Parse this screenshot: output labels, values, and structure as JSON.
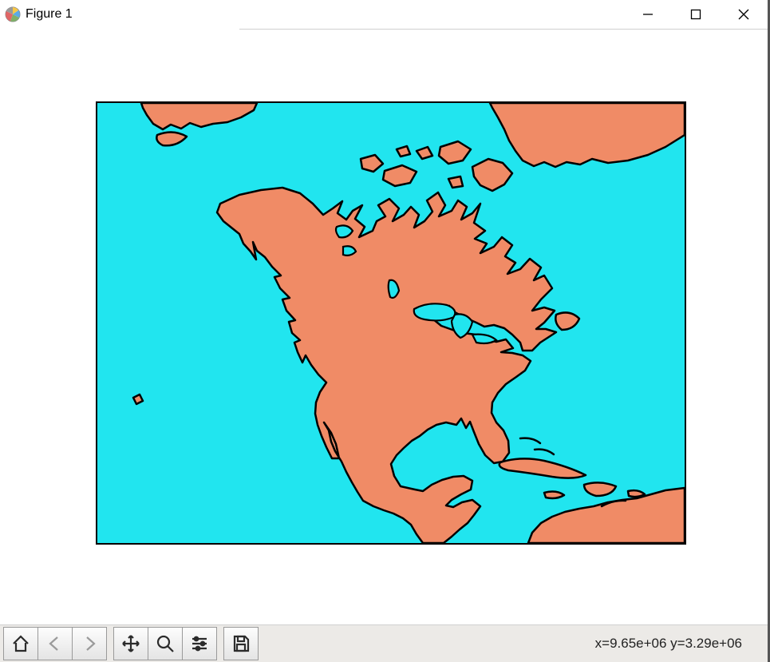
{
  "window": {
    "title": "Figure 1"
  },
  "titlebar": {
    "minimize": "minimize",
    "maximize": "maximize",
    "close": "close"
  },
  "toolbar": {
    "home": "home",
    "back": "back",
    "forward": "forward",
    "pan": "pan",
    "zoom": "zoom",
    "configure": "configure",
    "save": "save"
  },
  "status": {
    "coords": "x=9.65e+06 y=3.29e+06"
  },
  "map": {
    "ocean_color": "#21e5ef",
    "land_color": "#f08b66",
    "region": "North America",
    "cursor_x": "9.65e+06",
    "cursor_y": "3.29e+06"
  }
}
